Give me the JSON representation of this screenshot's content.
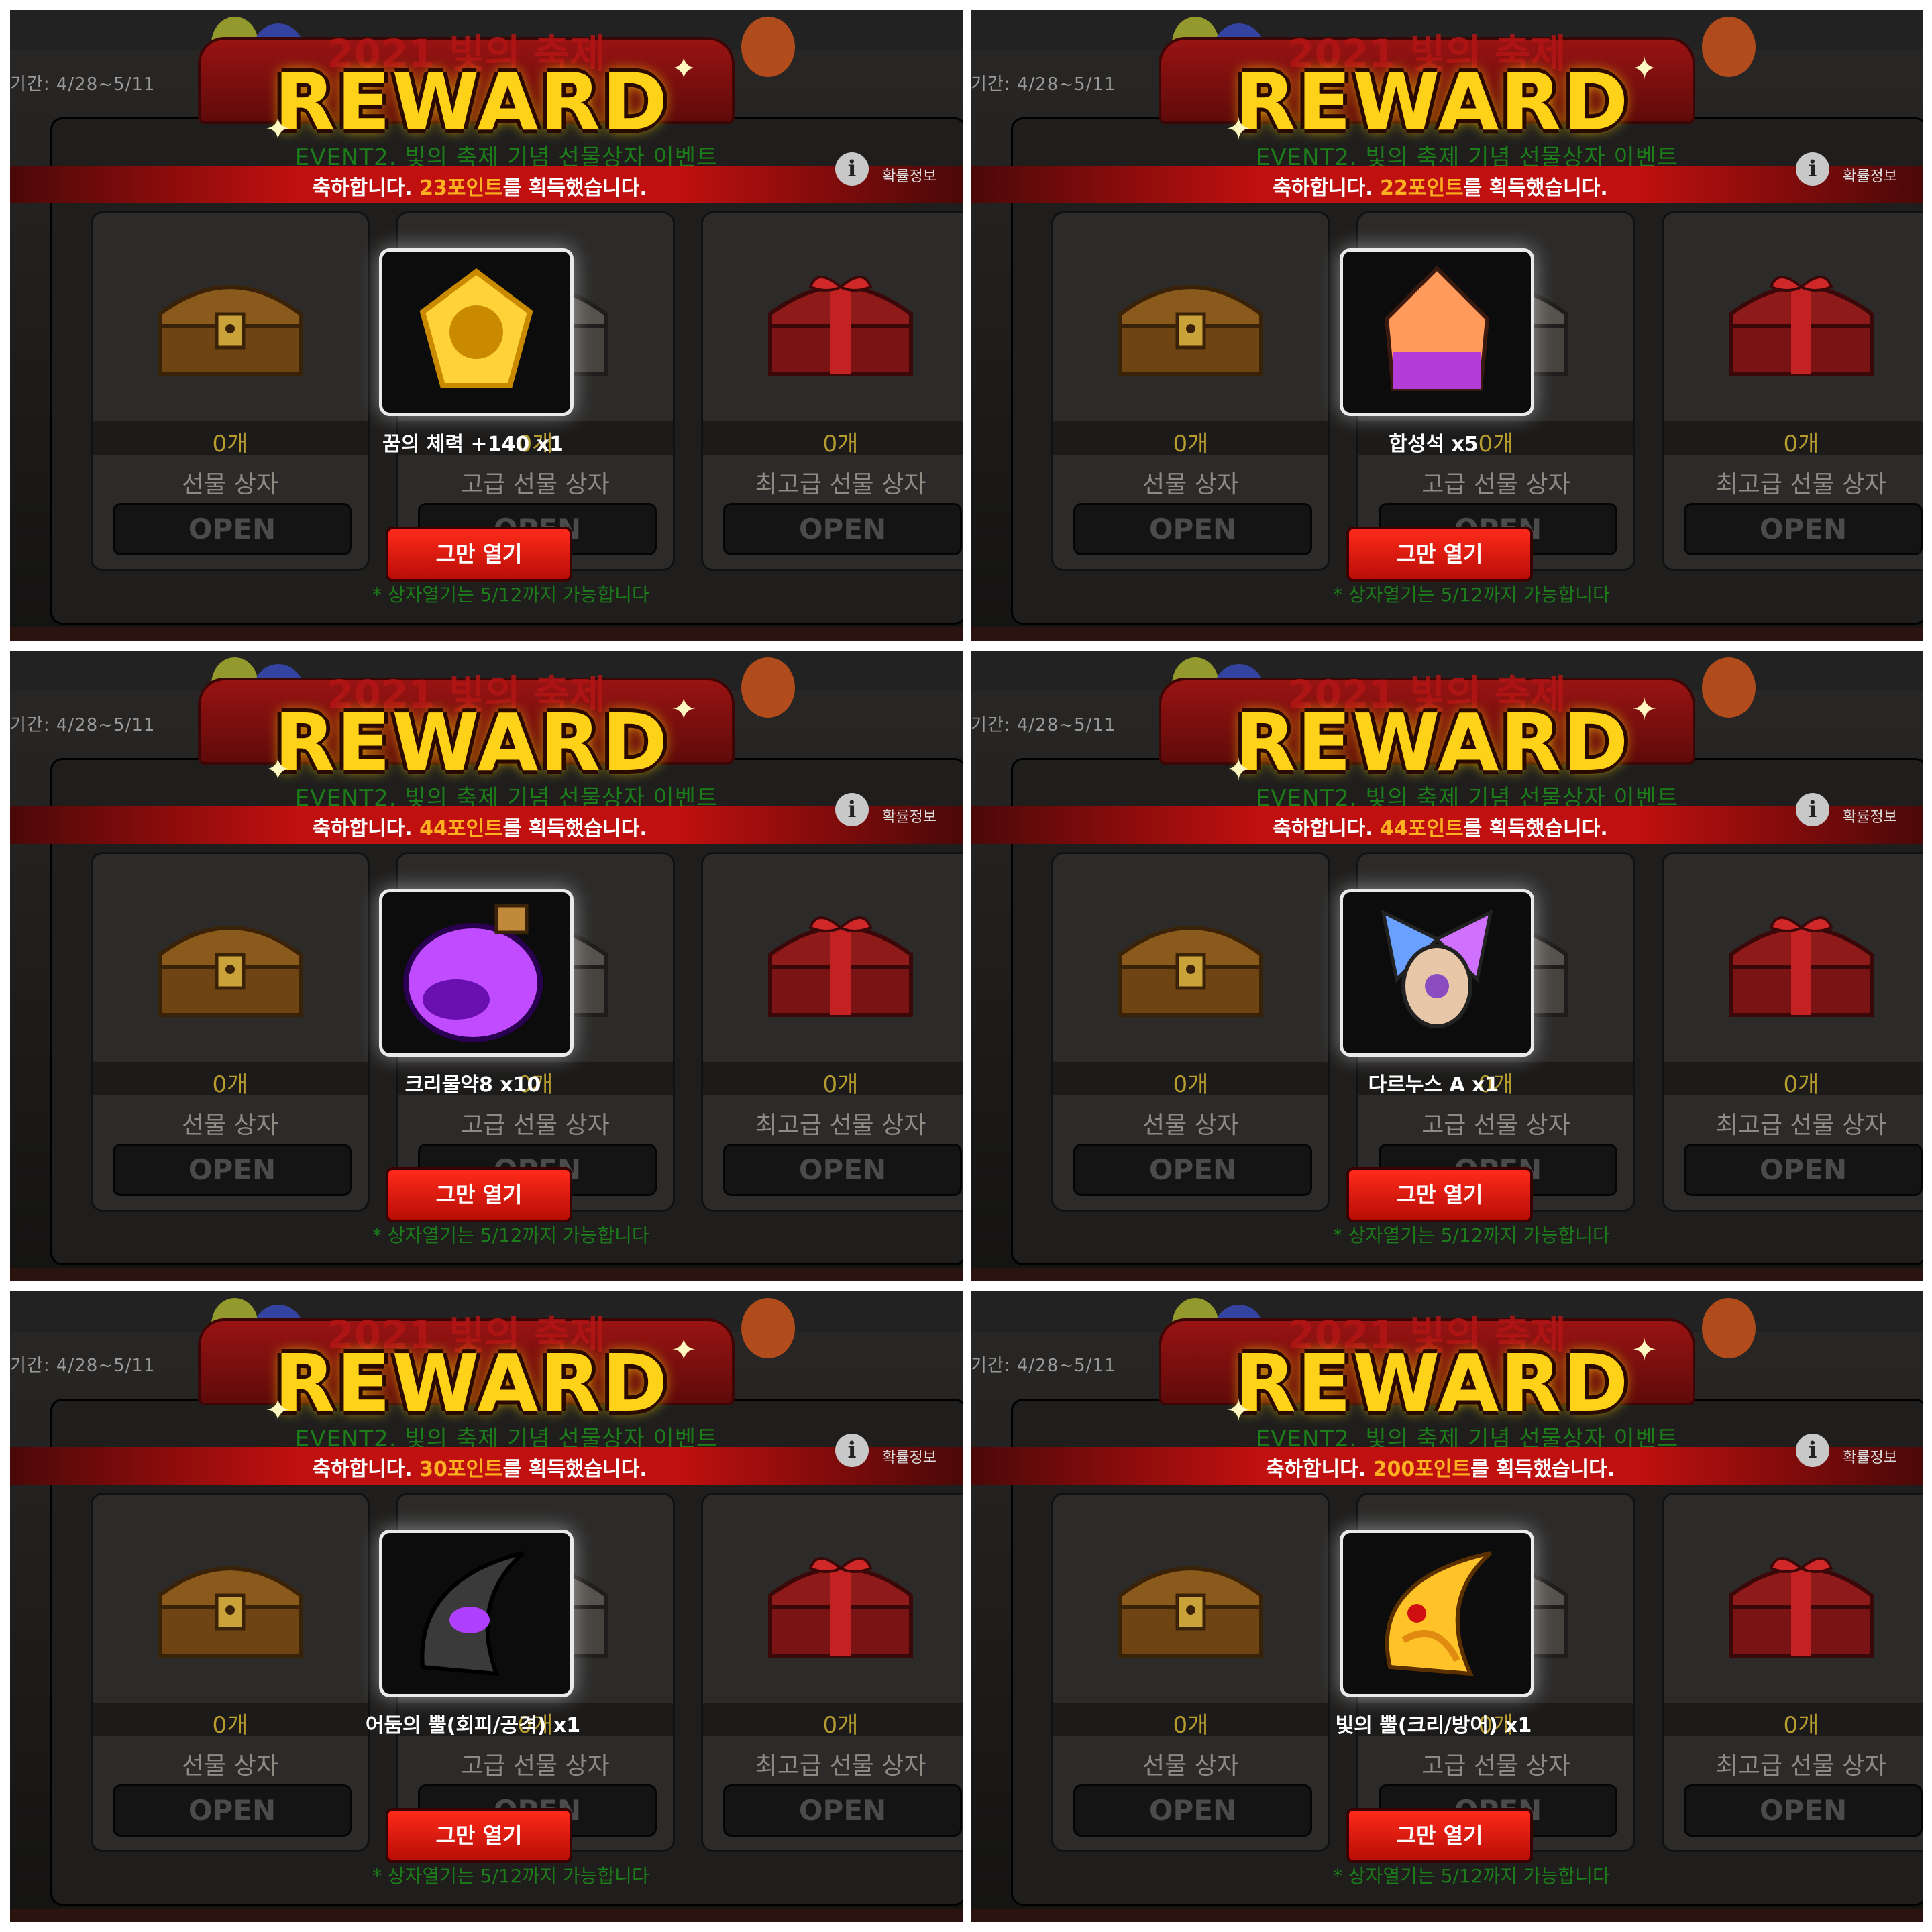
{
  "common": {
    "period": "기간: 4/28~5/11",
    "banner_title": "2021 빛의 축제",
    "reward_title": "REWARD",
    "event_subtitle": "EVENT2. 빛의 축제 기념 선물상자 이벤트",
    "msg_prefix": "축하합니다. ",
    "msg_suffix": "를 획득했습니다.",
    "info_label": "확률정보",
    "stop_button": "그만 열기",
    "notice": "* 상자열기는 5/12까지 가능합니다",
    "open_label": "OPEN",
    "boxes": [
      {
        "count": "0개",
        "name": "선물 상자"
      },
      {
        "count": "0개",
        "name": "고급 선물 상자"
      },
      {
        "count": "0개",
        "name": "최고급 선물 상자"
      }
    ],
    "colors": {
      "reward_gold": "#ffd21a",
      "banner_red": "#c0100f",
      "event_green": "#1c7d1a",
      "points_orange": "#ffb020"
    }
  },
  "panels": [
    {
      "points": "23포인트",
      "item": "꿈의 체력 +140 x1",
      "icon": "gold-emblem-icon",
      "icon_colors": [
        "#ffd23a",
        "#c98a00"
      ]
    },
    {
      "points": "22포인트",
      "item": "합성석 x5",
      "icon": "crystal-stone-icon",
      "icon_colors": [
        "#ff9a5a",
        "#b43cd8"
      ]
    },
    {
      "points": "44포인트",
      "item": "크리물약8 x10",
      "icon": "purple-potion-icon",
      "icon_colors": [
        "#c14cff",
        "#6a10b0"
      ]
    },
    {
      "points": "44포인트",
      "item": "다르누스 A x1",
      "icon": "winged-pet-icon",
      "icon_colors": [
        "#e7c7a8",
        "#8a4cc0"
      ]
    },
    {
      "points": "30포인트",
      "item": "어둠의 뿔(회피/공격) x1",
      "icon": "dark-horn-icon",
      "icon_colors": [
        "#3a3a3a",
        "#b040ff"
      ]
    },
    {
      "points": "200포인트",
      "item": "빛의 뿔(크리/방어) x1",
      "icon": "golden-horn-icon",
      "icon_colors": [
        "#ffc229",
        "#e08a10"
      ]
    }
  ]
}
